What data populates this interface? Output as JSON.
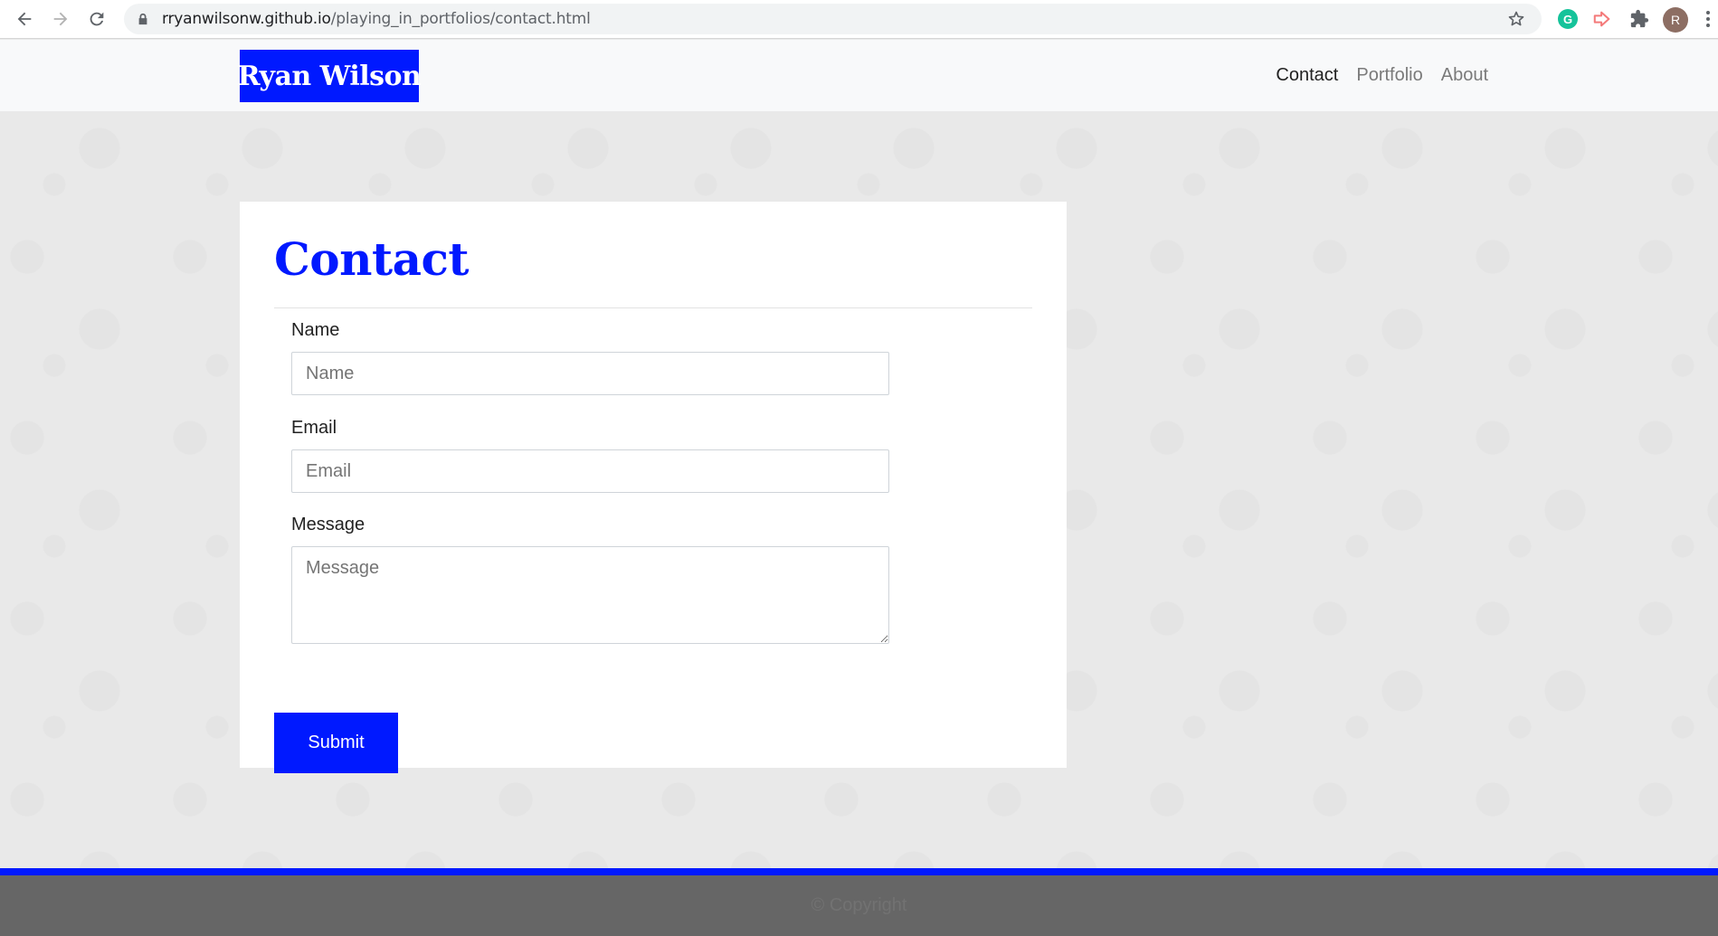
{
  "browser": {
    "url_host": "rryanwilsonw.github.io",
    "url_path": "/playing_in_portfolios/contact.html",
    "profile_initial": "R",
    "grammarly_letter": "G",
    "icons": [
      "back-arrow-icon",
      "forward-arrow-icon",
      "reload-icon",
      "lock-icon",
      "star-icon",
      "grammarly-icon",
      "extension-arrow-icon",
      "puzzle-icon",
      "menu-dots-icon"
    ]
  },
  "site": {
    "brand": "Ryan Wilson",
    "brand_color": "#0019ff",
    "nav": [
      {
        "label": "Contact",
        "active": true
      },
      {
        "label": "Portfolio",
        "active": false
      },
      {
        "label": "About",
        "active": false
      }
    ]
  },
  "contact": {
    "title": "Contact",
    "fields": {
      "name": {
        "label": "Name",
        "placeholder": "Name",
        "value": ""
      },
      "email": {
        "label": "Email",
        "placeholder": "Email",
        "value": ""
      },
      "message": {
        "label": "Message",
        "placeholder": "Message",
        "value": ""
      }
    },
    "submit_label": "Submit"
  },
  "footer": {
    "text": "© Copyright"
  }
}
